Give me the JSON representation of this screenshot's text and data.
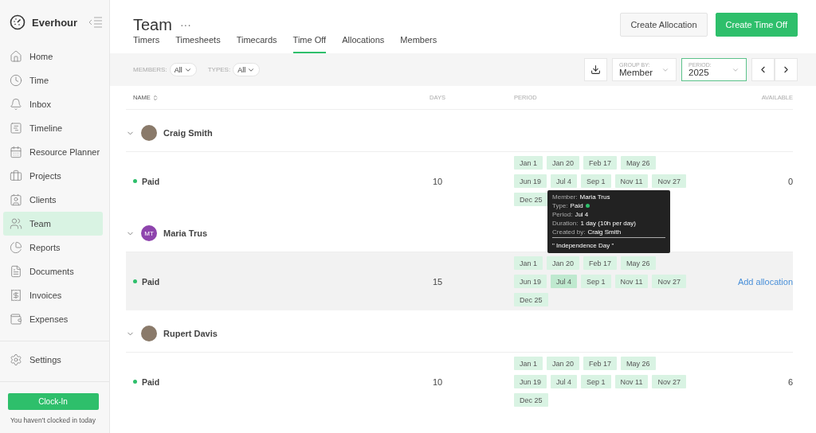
{
  "sidebar": {
    "brand": "Everhour",
    "items": [
      {
        "label": "Home",
        "selected": false
      },
      {
        "label": "Time",
        "selected": false
      },
      {
        "label": "Inbox",
        "selected": false
      },
      {
        "label": "Timeline",
        "selected": false
      },
      {
        "label": "Resource Planner",
        "selected": false
      },
      {
        "label": "Projects",
        "selected": false
      },
      {
        "label": "Clients",
        "selected": false
      },
      {
        "label": "Team",
        "selected": true
      },
      {
        "label": "Reports",
        "selected": false
      },
      {
        "label": "Documents",
        "selected": false
      },
      {
        "label": "Invoices",
        "selected": false
      },
      {
        "label": "Expenses",
        "selected": false
      }
    ],
    "settings": "Settings",
    "clock_in": "Clock-In",
    "clock_status": "You haven't clocked in today"
  },
  "header": {
    "title": "Team",
    "more": "···",
    "buttons": [
      {
        "label": "Create Allocation",
        "kind": "secondary"
      },
      {
        "label": "Create Time Off",
        "kind": "primary"
      }
    ]
  },
  "tabs": [
    {
      "label": "Timers",
      "selected": false
    },
    {
      "label": "Timesheets",
      "selected": false
    },
    {
      "label": "Timecards",
      "selected": false
    },
    {
      "label": "Time Off",
      "selected": true
    },
    {
      "label": "Allocations",
      "selected": false
    },
    {
      "label": "Members",
      "selected": false
    }
  ],
  "filters": [
    {
      "label": "MEMBERS:",
      "value": "All"
    },
    {
      "label": "TYPES:",
      "value": "All"
    }
  ],
  "selects": [
    {
      "label": "GROUP BY:",
      "value": "Member",
      "focused": false
    },
    {
      "label": "PERIOD:",
      "value": "2025",
      "focused": true
    }
  ],
  "table": {
    "columns": [
      "NAME",
      "DAYS",
      "PERIOD",
      "AVAILABLE"
    ],
    "groups": [
      {
        "name": "Craig Smith",
        "highlighted": false,
        "type": "Paid",
        "days": "10",
        "available": "0",
        "chips": [
          {
            "label": "Jan 1",
            "selected": false
          },
          {
            "label": "Jan 20",
            "selected": false
          },
          {
            "label": "Feb 17",
            "selected": false
          },
          {
            "label": "May 26",
            "selected": false
          },
          {
            "label": "Jun 19",
            "selected": false
          },
          {
            "label": "Jul 4",
            "selected": false
          },
          {
            "label": "Sep 1",
            "selected": false
          },
          {
            "label": "Nov 11",
            "selected": false
          },
          {
            "label": "Nov 27",
            "selected": false
          },
          {
            "label": "Dec 25",
            "selected": false
          }
        ]
      },
      {
        "name": "Maria Trus",
        "initials": "MT",
        "highlighted": true,
        "type": "Paid",
        "days": "15",
        "action": "Add allocation",
        "chips": [
          {
            "label": "Jan 1",
            "selected": false
          },
          {
            "label": "Jan 20",
            "selected": false
          },
          {
            "label": "Feb 17",
            "selected": false
          },
          {
            "label": "May 26",
            "selected": false
          },
          {
            "label": "Jun 19",
            "selected": false
          },
          {
            "label": "Jul 4",
            "selected": true
          },
          {
            "label": "Sep 1",
            "selected": false
          },
          {
            "label": "Nov 11",
            "selected": false
          },
          {
            "label": "Nov 27",
            "selected": false
          },
          {
            "label": "Dec 25",
            "selected": false
          }
        ],
        "tooltip": {
          "lines": [
            {
              "label": "Member:",
              "value": "Maria Trus"
            },
            {
              "label": "Type:",
              "value": "Paid",
              "dot": true
            },
            {
              "label": "Period:",
              "value": "Jul 4"
            },
            {
              "label": "Duration:",
              "value": "1 day (10h per day)"
            },
            {
              "label": "Created by:",
              "value": "Craig Smith"
            }
          ],
          "note": "\" Independence Day \""
        }
      },
      {
        "name": "Rupert Davis",
        "highlighted": false,
        "type": "Paid",
        "days": "10",
        "available": "6",
        "chips": [
          {
            "label": "Jan 1",
            "selected": false
          },
          {
            "label": "Jan 20",
            "selected": false
          },
          {
            "label": "Feb 17",
            "selected": false
          },
          {
            "label": "May 26",
            "selected": false
          },
          {
            "label": "Jun 19",
            "selected": false
          },
          {
            "label": "Jul 4",
            "selected": false
          },
          {
            "label": "Sep 1",
            "selected": false
          },
          {
            "label": "Nov 11",
            "selected": false
          },
          {
            "label": "Nov 27",
            "selected": false
          },
          {
            "label": "Dec 25",
            "selected": false
          }
        ]
      }
    ]
  }
}
